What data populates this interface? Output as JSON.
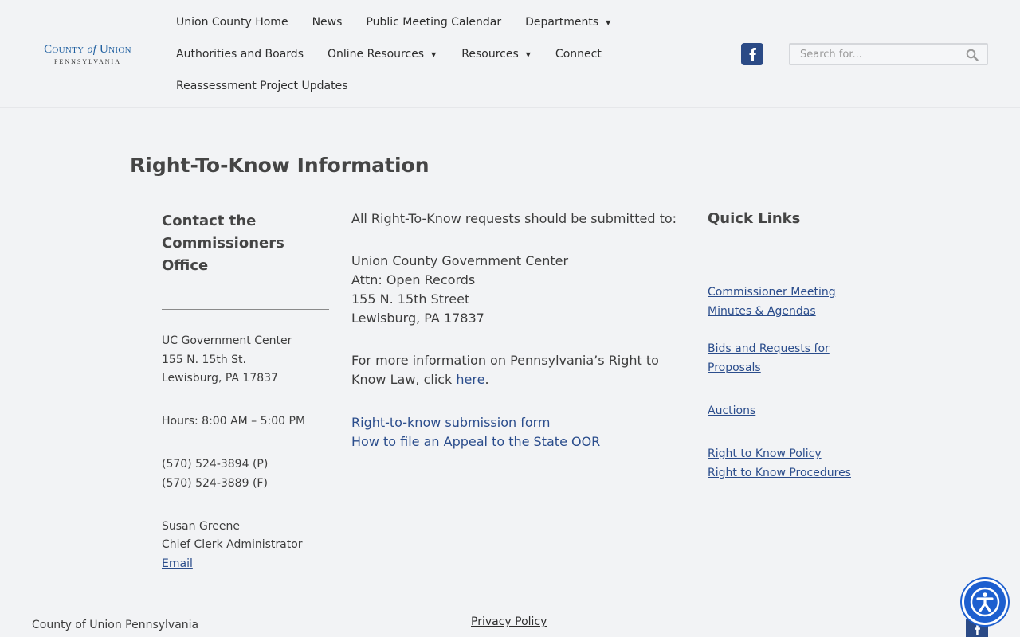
{
  "logo": {
    "main_1": "County",
    "of": "of",
    "main_2": "Union",
    "sub": "PENNSYLVANIA"
  },
  "nav": {
    "row1": [
      {
        "label": "Union County Home",
        "dropdown": false
      },
      {
        "label": "News",
        "dropdown": false
      },
      {
        "label": "Public Meeting Calendar",
        "dropdown": false
      },
      {
        "label": "Departments",
        "dropdown": true
      }
    ],
    "row2": [
      {
        "label": "Authorities and Boards",
        "dropdown": false
      },
      {
        "label": "Online Resources",
        "dropdown": true
      },
      {
        "label": "Resources",
        "dropdown": true
      },
      {
        "label": "Connect",
        "dropdown": false
      }
    ],
    "row3": [
      {
        "label": "Reassessment Project Updates",
        "dropdown": false
      }
    ],
    "caret": "▼"
  },
  "search": {
    "placeholder": "Search for..."
  },
  "page": {
    "title": "Right-To-Know Information"
  },
  "contact": {
    "heading_line1": "Contact the",
    "heading_line2": "Commissioners Office",
    "address1": "UC Government Center",
    "address2": "155 N. 15th St.",
    "address3": "Lewisburg, PA 17837",
    "hours": "Hours: 8:00 AM – 5:00 PM",
    "phone": "(570) 524-3894 (P)",
    "fax": "(570) 524-3889 (F)",
    "name": "Susan Greene",
    "role": "Chief Clerk Administrator",
    "email_link": "Email"
  },
  "requests": {
    "intro": "All Right-To-Know requests should be submitted to:",
    "addr1": "Union County Government Center",
    "addr2": "Attn: Open Records",
    "addr3": "155 N. 15th Street",
    "addr4": "Lewisburg, PA 17837",
    "more_info_line1": "For more information on Pennsylvania’s Right to",
    "more_info_line2": "Know Law, click ",
    "here_link": "here",
    "period": ".",
    "form_link": "Right-to-know submission form",
    "appeal_link": "How to file an Appeal to the State OOR"
  },
  "quick_links": {
    "heading": "Quick Links",
    "links": [
      {
        "line1": "Commissioner Meeting",
        "line2": "Minutes & Agendas"
      },
      {
        "line1": "Bids and Requests for",
        "line2": "Proposals"
      },
      {
        "line1": "Auctions"
      },
      {
        "line1": "Right to Know Policy"
      },
      {
        "line1": "Right to Know Procedures"
      }
    ]
  },
  "footer": {
    "org": "County of Union Pennsylvania",
    "privacy": "Privacy Policy"
  },
  "colors": {
    "accent": "#2b4d8c",
    "brand_blue": "#1f5fa0",
    "facebook": "#2b4a86",
    "a11y": "#1d5fcf"
  }
}
